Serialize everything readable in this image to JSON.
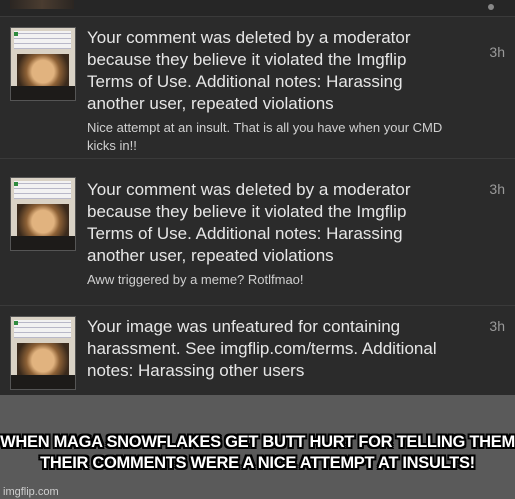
{
  "notifications": [
    {
      "message": "Your comment was deleted by a moderator because they believe it violated the Imgflip Terms of Use. Additional notes: Harassing another user, repeated violations",
      "comment": "Nice attempt at an insult. That is all you have when your CMD kicks in!!",
      "time": "3h"
    },
    {
      "message": "Your comment was deleted by a moderator because they believe it violated the Imgflip Terms of Use. Additional notes: Harassing another user, repeated violations",
      "comment": "Aww triggered by a meme? Rotlfmao!",
      "time": "3h"
    },
    {
      "message": "Your image was unfeatured for containing harassment. See imgflip.com/terms. Additional notes: Harassing other users",
      "comment": "",
      "time": "3h"
    }
  ],
  "caption": "WHEN MAGA SNOWFLAKES GET BUTT HURT FOR TELLING THEM THEIR COMMENTS WERE A NICE ATTEMPT AT INSULTS!",
  "watermark": "imgflip.com",
  "colors": {
    "background": "#1f1f1f",
    "card": "#2b2b2b",
    "caption_bg": "#5a5a5a",
    "text": "#e6e6e6",
    "time": "#9a9a9a"
  }
}
